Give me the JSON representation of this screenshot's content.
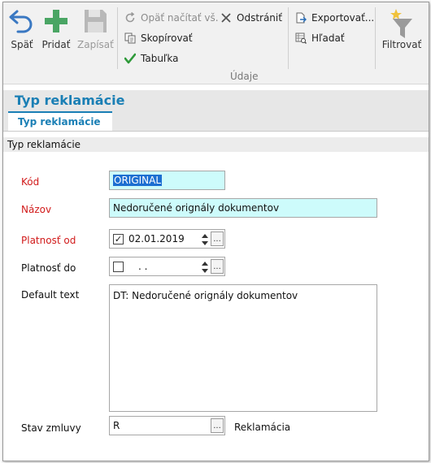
{
  "ribbon": {
    "back_label": "Späť",
    "add_label": "Pridať",
    "save_label": "Zapísať",
    "reload_label": "Opäť načítať vš.",
    "delete_label": "Odstrániť",
    "copy_label": "Skopírovať",
    "table_label": "Tabuľka",
    "export_label": "Exportovať...",
    "find_label": "Hľadať",
    "filter_label": "Filtrovať",
    "group_label": "Údaje"
  },
  "header": {
    "title": "Typ reklamácie",
    "tab_label": "Typ reklamácie",
    "section_label": "Typ reklamácie"
  },
  "form": {
    "kod_label": "Kód",
    "kod_value": "ORIGINAL",
    "nazov_label": "Názov",
    "nazov_value": "Nedoručené orignály dokumentov",
    "platnost_od_label": "Platnosť od",
    "platnost_od_value": "02.01.2019",
    "platnost_od_checked": true,
    "platnost_do_label": "Platnosť do",
    "platnost_do_value": ".  .",
    "platnost_do_checked": false,
    "default_text_label": "Default text",
    "default_text_value": "DT: Nedoručené orignály dokumentov",
    "stav_label": "Stav zmluvy",
    "stav_value": "R",
    "stav_description": "Reklamácia",
    "dots_label": "..."
  },
  "colors": {
    "accent": "#1a7fb5",
    "required_label": "#d11a1a",
    "highlight_input": "#cdfbfb",
    "selection": "#1c6fd1"
  }
}
